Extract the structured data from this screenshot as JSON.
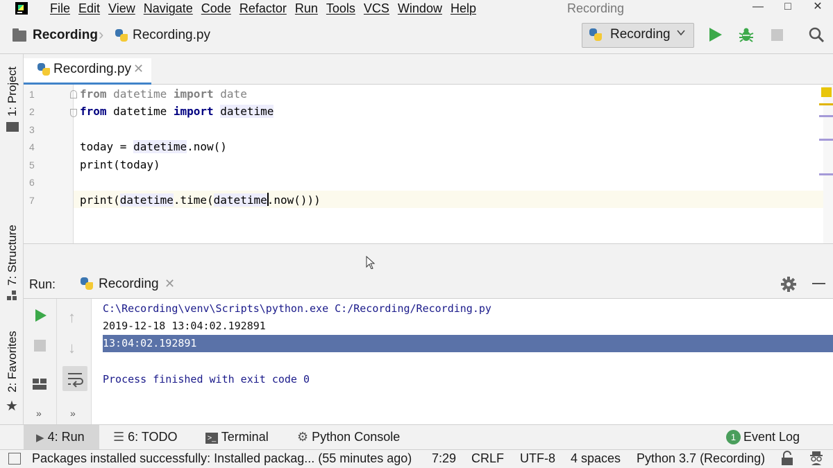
{
  "menu": [
    "File",
    "Edit",
    "View",
    "Navigate",
    "Code",
    "Refactor",
    "Run",
    "Tools",
    "VCS",
    "Window",
    "Help"
  ],
  "window_title": "Recording",
  "breadcrumb": {
    "project": "Recording",
    "file": "Recording.py"
  },
  "run_config": {
    "label": "Recording"
  },
  "left_tool_tabs": {
    "project": "1: Project",
    "structure": "7: Structure",
    "favorites": "2: Favorites"
  },
  "editor": {
    "tab_label": "Recording.py",
    "line_numbers": [
      "1",
      "2",
      "3",
      "4",
      "5",
      "6",
      "7"
    ],
    "lines": [
      "from datetime import date",
      "from datetime import datetime",
      "",
      "today = datetime.now()",
      "print(today)",
      "",
      "print(datetime.time(datetime.now()))"
    ],
    "caret": "7:29"
  },
  "run_panel": {
    "label": "Run:",
    "tab_label": "Recording",
    "console": [
      "C:\\Recording\\venv\\Scripts\\python.exe C:/Recording/Recording.py",
      "2019-12-18 13:04:02.192891",
      "13:04:02.192891",
      "",
      "Process finished with exit code 0"
    ],
    "more": "»"
  },
  "bottom_tabs": {
    "run": "4: Run",
    "todo": "6: TODO",
    "terminal": "Terminal",
    "python_console": "Python Console",
    "event_log": "Event Log",
    "event_count": "1"
  },
  "status": {
    "message": "Packages installed successfully: Installed packag... (55 minutes ago)",
    "position": "7:29",
    "line_sep": "CRLF",
    "encoding": "UTF-8",
    "indent": "4 spaces",
    "interpreter": "Python 3.7 (Recording)"
  },
  "colors": {
    "accent": "#4083c9",
    "run_green": "#3ca94a",
    "selection": "#5a72a8",
    "keyword": "#000080",
    "warning": "#e8c50a"
  }
}
